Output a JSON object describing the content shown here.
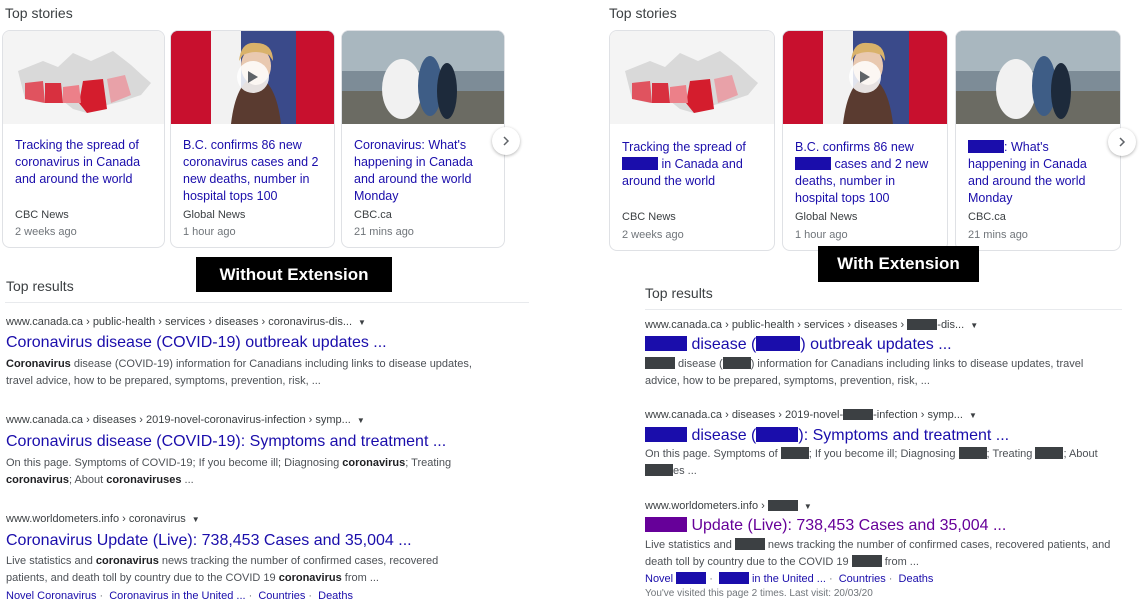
{
  "left": {
    "top_stories_heading": "Top stories",
    "cards": [
      {
        "headline": "Tracking the spread of coronavirus in Canada and around the world",
        "source": "CBC News",
        "age": "2 weeks ago"
      },
      {
        "headline": "B.C. confirms 86 new coronavirus cases and 2 new deaths, number in hospital tops 100",
        "source": "Global News",
        "age": "1 hour ago"
      },
      {
        "headline": "Coronavirus: What's happening in Canada and around the world Monday",
        "source": "CBC.ca",
        "age": "21 mins ago"
      }
    ],
    "label": "Without Extension",
    "top_results_heading": "Top results",
    "results": [
      {
        "url": "www.canada.ca › public-health › services › diseases › coronavirus-dis...",
        "title": "Coronavirus disease (COVID-19) outbreak updates ...",
        "s1b": "Coronavirus",
        "s1": " disease (COVID-19) information for Canadians including links to disease updates,",
        "s2": "travel advice, how to be prepared, symptoms, prevention, risk, ..."
      },
      {
        "url": "www.canada.ca › diseases › 2019-novel-coronavirus-infection › symp...",
        "title": "Coronavirus disease (COVID-19): Symptoms and treatment ...",
        "s1": "On this page. Symptoms of COVID-19; If you become ill; Diagnosing ",
        "s1b": "coronavirus",
        "s1c": "; Treating",
        "s2b": "coronavirus",
        "s2": "; About ",
        "s2b2": "coronaviruses",
        "s2c": " ..."
      },
      {
        "url": "www.worldometers.info › coronavirus",
        "title": "Coronavirus Update (Live): 738,453 Cases and 35,004 ...",
        "s1": "Live statistics and ",
        "s1b": "coronavirus",
        "s1c": " news tracking the number of confirmed cases, recovered",
        "s2": "patients, and death toll by country due to the COVID 19 ",
        "s2b": "coronavirus",
        "s2c": " from ...",
        "links": [
          "Novel Coronavirus",
          "Coronavirus in the United ...",
          "Countries",
          "Deaths"
        ]
      }
    ]
  },
  "right": {
    "top_stories_heading": "Top stories",
    "cards": [
      {
        "h1": "Tracking the spread of",
        "h2": " in Canada and",
        "h3": "around the world",
        "source": "CBC News",
        "age": "2 weeks ago"
      },
      {
        "h1": "B.C. confirms 86 new",
        "h2": " cases and 2 new",
        "h3": "deaths, number in",
        "h4": "hospital tops 100",
        "source": "Global News",
        "age": "1 hour ago"
      },
      {
        "h1": ": What's",
        "h2": "happening in Canada",
        "h3": "and around the world",
        "h4": "Monday",
        "source": "CBC.ca",
        "age": "21 mins ago"
      }
    ],
    "label": "With Extension",
    "top_results_heading": "Top results",
    "results": [
      {
        "url_a": "www.canada.ca › public-health › services › diseases › ",
        "url_b": "-dis...",
        "title_a": " disease (",
        "title_b": ") outbreak updates ...",
        "s1a": " disease (",
        "s1b": ") information for Canadians including links to disease updates, travel",
        "s2": "advice, how to be prepared, symptoms, prevention, risk, ..."
      },
      {
        "url_a": "www.canada.ca › diseases › 2019-novel-",
        "url_b": "-infection › symp...",
        "title_a": " disease (",
        "title_b": "): Symptoms and treatment ...",
        "s1a": "On this page. Symptoms of ",
        "s1b": "; If you become ill; Diagnosing ",
        "s1c": "; Treating ",
        "s1d": "; About",
        "s2": "es ..."
      },
      {
        "url_a": "www.worldometers.info › ",
        "title_b": " Update (Live): 738,453 Cases and 35,004 ...",
        "s1a": "Live statistics and ",
        "s1b": " news tracking the number of confirmed cases, recovered patients, and",
        "s2a": "death toll by country due to the COVID 19 ",
        "s2b": " from ...",
        "link1a": "Novel ",
        "link2a": " in the United ...",
        "link3": "Countries",
        "link4": "Deaths",
        "visited": "You've visited this page 2 times. Last visit: 20/03/20"
      }
    ]
  },
  "icons": [
    "chevron-right-icon",
    "play-icon",
    "dropdown-arrow-icon"
  ],
  "colors": {
    "link": "#1a0dab",
    "visited": "#660099",
    "redact_dark": "#3c4043"
  }
}
